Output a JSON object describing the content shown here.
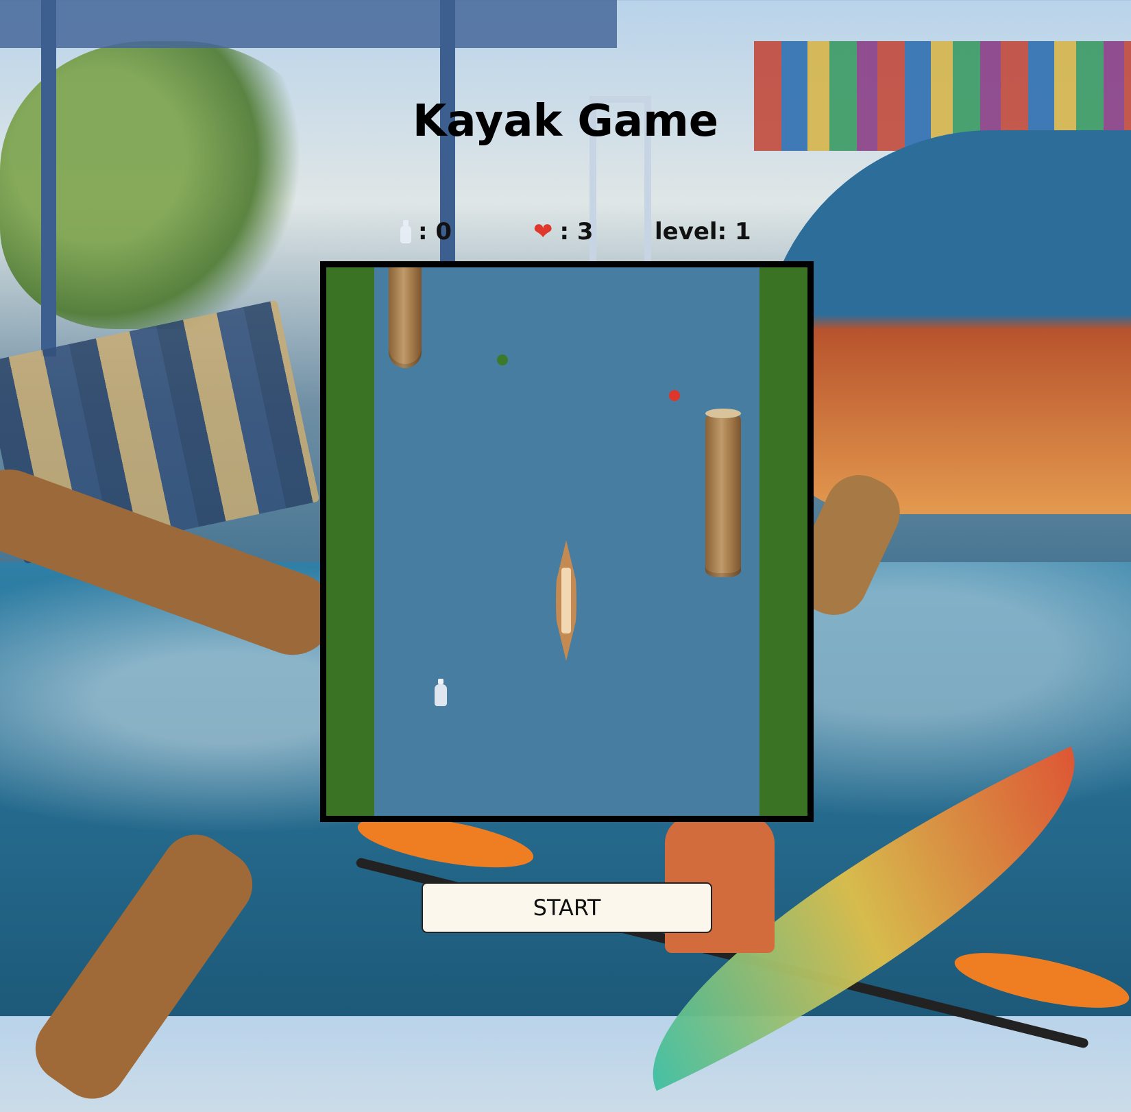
{
  "page": {
    "title": "Kayak Game"
  },
  "stats": {
    "bottles": {
      "icon": "bottle-icon",
      "value": ": 0"
    },
    "lives": {
      "icon": "heart-icon",
      "value": ": 3"
    },
    "level": {
      "label": "level: 1"
    }
  },
  "game": {
    "colors": {
      "water": "#477da0",
      "bank": "#3b7324",
      "border": "#000000"
    },
    "objects": [
      "log",
      "log",
      "green-dot",
      "red-dot",
      "kayak",
      "bottle"
    ]
  },
  "controls": {
    "start_label": "START"
  }
}
